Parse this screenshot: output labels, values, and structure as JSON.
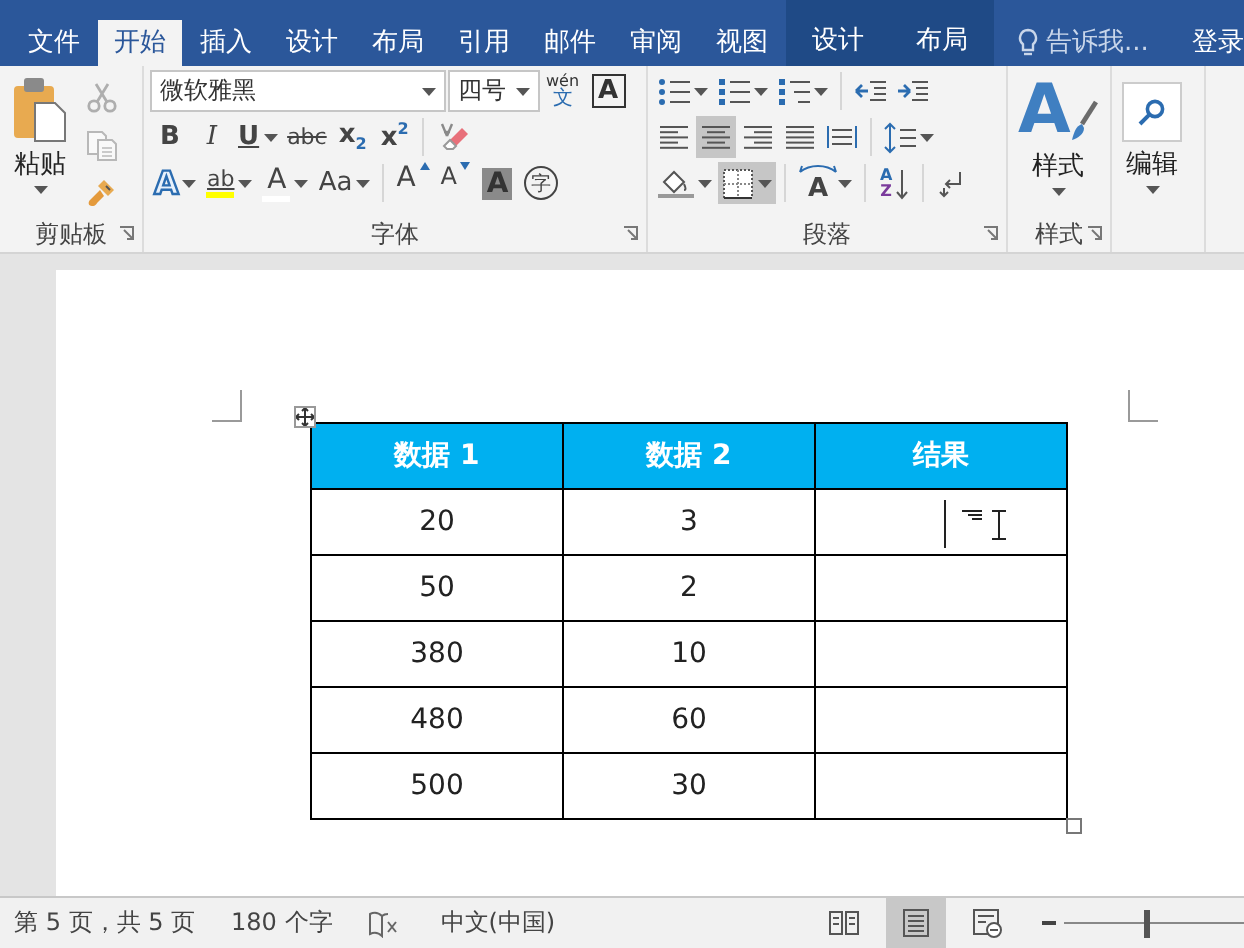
{
  "tabs": [
    {
      "label": "文件",
      "selected": false,
      "kind": "main"
    },
    {
      "label": "开始",
      "selected": true,
      "kind": "main"
    },
    {
      "label": "插入",
      "selected": false,
      "kind": "main"
    },
    {
      "label": "设计",
      "selected": false,
      "kind": "main"
    },
    {
      "label": "布局",
      "selected": false,
      "kind": "main"
    },
    {
      "label": "引用",
      "selected": false,
      "kind": "main"
    },
    {
      "label": "邮件",
      "selected": false,
      "kind": "main"
    },
    {
      "label": "审阅",
      "selected": false,
      "kind": "main"
    },
    {
      "label": "视图",
      "selected": false,
      "kind": "main"
    },
    {
      "label": "设计",
      "selected": false,
      "kind": "context"
    },
    {
      "label": "布局",
      "selected": false,
      "kind": "context"
    }
  ],
  "tell_me": {
    "placeholder": "告诉我..."
  },
  "sign_in": "登录",
  "clipboard": {
    "paste": "粘贴",
    "label": "剪贴板",
    "tools": [
      {
        "disabled": true
      },
      {
        "disabled": true
      },
      {
        "disabled": false
      }
    ]
  },
  "font": {
    "name": "微软雅黑",
    "size": "四号",
    "phonetic": {
      "top": "wén",
      "bottom": "文"
    },
    "border_char": "A",
    "row_2": [
      {
        "label": "B",
        "kind": "bold",
        "dropdown": false
      },
      {
        "label": "I",
        "kind": "italic",
        "dropdown": false
      },
      {
        "label": "U",
        "kind": "underline",
        "dropdown": true
      },
      {
        "label": "abc",
        "kind": "strike",
        "dropdown": false
      },
      {
        "label": "x$_{2}$",
        "kind": "script",
        "dropdown": false
      },
      {
        "label": "x$^{2}$",
        "kind": "script",
        "dropdown": false
      }
    ],
    "row_3": [
      {
        "label": "A",
        "kind": "effects",
        "dropdown": true
      },
      {
        "label": "ab",
        "kind": "highlight",
        "dropdown": true,
        "color": "#ffff00"
      },
      {
        "label": "A",
        "kind": "color",
        "dropdown": true,
        "color": "#ffffff"
      },
      {
        "label": "Aa",
        "kind": "plain",
        "dropdown": true
      }
    ],
    "sizing": [
      {
        "label": "A",
        "kind": "grow"
      },
      {
        "label": "A",
        "kind": "shrink"
      },
      {
        "label": "A",
        "kind": "shaded"
      },
      {
        "label": "字",
        "kind": "enclosed"
      }
    ],
    "label": "字体"
  },
  "paragraph": {
    "align": [
      {
        "selected": false
      },
      {
        "selected": true
      },
      {
        "selected": false
      },
      {
        "selected": false
      },
      {
        "selected": false
      }
    ],
    "borders_pressed": true,
    "layout": "A",
    "sort": {
      "top": "A",
      "bottom": "Z"
    },
    "label": "段落"
  },
  "styles": {
    "glyph": "A",
    "button": "样式",
    "label": "样式"
  },
  "editing": {
    "button": "编辑"
  },
  "table": {
    "columns": [
      "数据 1",
      "数据 2",
      "结果"
    ],
    "rows": [
      [
        "20",
        "3"
      ],
      [
        "50",
        "2"
      ],
      [
        "380",
        "10"
      ],
      [
        "480",
        "60"
      ],
      [
        "500",
        "30"
      ]
    ]
  },
  "status_bar": {
    "page": "第 5 页，共 5 页",
    "words": "180 个字",
    "language": "中文(中国)",
    "views": [
      {
        "selected": false
      },
      {
        "selected": true
      },
      {
        "selected": false
      }
    ],
    "zoom": {
      "level": 0.45
    }
  }
}
